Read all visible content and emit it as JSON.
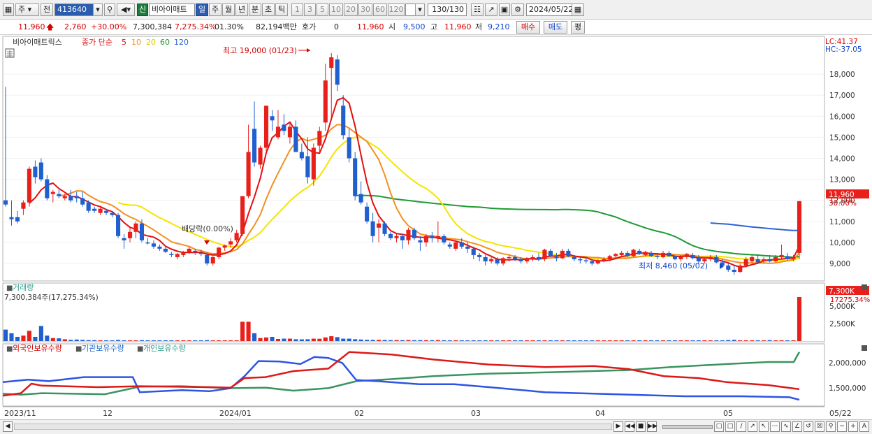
{
  "toolbar": {
    "market": "주",
    "prev_label": "전",
    "code": "413640",
    "new_badge": "신",
    "stock_name": "비아이매트",
    "periods": [
      "일",
      "주",
      "월",
      "년",
      "분",
      "초",
      "틱"
    ],
    "active_period": "일",
    "intervals": [
      "1",
      "3",
      "5",
      "10",
      "20",
      "30",
      "60",
      "120"
    ],
    "count": "130/130",
    "date": "2024/05/22"
  },
  "quote": {
    "price": "11,960",
    "change": "2,760",
    "change_pct": "+30.00%",
    "volume": "7,300,384",
    "volume_ratio": "7,275.34%",
    "turnover": "01.30%",
    "amount": "82,194백만",
    "hoga_label": "호가",
    "hoga_value": "0",
    "hoga_price": "11,960",
    "open_label": "시",
    "open": "9,500",
    "high_label": "고",
    "high": "11,960",
    "low_label": "저",
    "low": "9,210",
    "buy_label": "매수",
    "sell_label": "매도",
    "eval_label": "평"
  },
  "price_panel": {
    "title": "비아이매트릭스",
    "indicator": "종가 단순",
    "ma_labels": [
      "5",
      "10",
      "20",
      "60",
      "120"
    ],
    "lc": "LC:41.37",
    "hc": "HC:-37.05",
    "high_note": "최고 19,000 (01/23)",
    "low_note": "최저 8,460 (05/02)",
    "dividend_note": "배당락(0.00%)",
    "last_price_tag": "11,960",
    "last_pct_tag": "30.00%",
    "y_ticks": [
      "18,000",
      "17,000",
      "16,000",
      "15,000",
      "14,000",
      "13,000",
      "12,000",
      "11,000",
      "10,000",
      "9,000"
    ]
  },
  "volume_panel": {
    "title": "거래량",
    "info": "7,300,384주(17,275.34%)",
    "last_tag": "7,300K",
    "last_pct": "17275.34%",
    "y_ticks": [
      "5,000K",
      "2,500K"
    ]
  },
  "holdings_panel": {
    "legend": [
      "외국인보유수량",
      "기관보유수량",
      "개인보유수량"
    ],
    "y_ticks": [
      "2,000,000",
      "1,500,000"
    ]
  },
  "x_axis": {
    "labels": [
      "2023/11",
      "12",
      "2024/01",
      "02",
      "03",
      "04",
      "05",
      "05/22"
    ]
  },
  "colors": {
    "up": "#e8201c",
    "down": "#1f5fd0",
    "ma5": "#e11010",
    "ma10": "#f39020",
    "ma20": "#f4e400",
    "ma60": "#1c9a32",
    "ma120": "#2a62d8",
    "foreign": "#2d55e0",
    "institution": "#dd1818",
    "individual": "#3a9460"
  },
  "chart_data": {
    "type": "candlestick",
    "title": "비아이매트릭스",
    "y_range": [
      8300,
      19200
    ],
    "x_dates": [
      "2023-11",
      "2023-12",
      "2024-01",
      "2024-02",
      "2024-03",
      "2024-04",
      "2024-05",
      "2024-05-22"
    ],
    "ohlc": [
      [
        12000,
        17400,
        11700,
        11800
      ],
      [
        11200,
        12000,
        10800,
        11100
      ],
      [
        11200,
        11500,
        10900,
        11000
      ],
      [
        11600,
        12000,
        11300,
        11900
      ],
      [
        11900,
        13600,
        11700,
        13500
      ],
      [
        13600,
        13900,
        12800,
        13100
      ],
      [
        13800,
        14000,
        12900,
        13000
      ],
      [
        13000,
        13200,
        12000,
        12100
      ],
      [
        12300,
        12500,
        11900,
        12400
      ],
      [
        12300,
        12500,
        12100,
        12200
      ],
      [
        12100,
        12300,
        12000,
        12200
      ],
      [
        12200,
        12500,
        11900,
        12000
      ],
      [
        12200,
        12400,
        11900,
        12100
      ],
      [
        12100,
        12400,
        11700,
        11800
      ],
      [
        11900,
        12000,
        11400,
        11500
      ],
      [
        11600,
        11700,
        11400,
        11500
      ],
      [
        11400,
        11700,
        11300,
        11600
      ],
      [
        11500,
        11600,
        11300,
        11400
      ],
      [
        11400,
        11500,
        11200,
        11300
      ],
      [
        11300,
        11400,
        10200,
        10300
      ],
      [
        10200,
        10400,
        9700,
        10100
      ],
      [
        10200,
        10700,
        10000,
        10500
      ],
      [
        10500,
        11000,
        10200,
        10900
      ],
      [
        10900,
        11100,
        10000,
        10100
      ],
      [
        10000,
        10200,
        9900,
        9950
      ],
      [
        9950,
        10100,
        9700,
        9800
      ],
      [
        9800,
        9900,
        9600,
        9700
      ],
      [
        9700,
        9850,
        9500,
        9550
      ],
      [
        9450,
        9550,
        9300,
        9400
      ],
      [
        9300,
        9500,
        9200,
        9450
      ],
      [
        9400,
        9600,
        9300,
        9500
      ],
      [
        9550,
        9800,
        9450,
        9700
      ],
      [
        9600,
        9700,
        9400,
        9550
      ],
      [
        9500,
        9650,
        9350,
        9450
      ],
      [
        9400,
        9550,
        8900,
        9000
      ],
      [
        9000,
        9350,
        8900,
        9300
      ],
      [
        9300,
        9800,
        9200,
        9750
      ],
      [
        9750,
        9900,
        9600,
        9850
      ],
      [
        9900,
        10200,
        9750,
        10050
      ],
      [
        10100,
        10600,
        10000,
        10450
      ],
      [
        10400,
        12200,
        10300,
        12200
      ],
      [
        12200,
        15600,
        12100,
        14300
      ],
      [
        15400,
        16700,
        13600,
        13800
      ],
      [
        13700,
        14600,
        13500,
        14500
      ],
      [
        14500,
        16500,
        14300,
        16500
      ],
      [
        16000,
        16300,
        15300,
        15800
      ],
      [
        15000,
        16300,
        14900,
        15500
      ],
      [
        15600,
        16100,
        15100,
        15300
      ],
      [
        15000,
        15700,
        14700,
        15500
      ],
      [
        15500,
        15800,
        14900,
        14300
      ],
      [
        14300,
        14700,
        13900,
        14000
      ],
      [
        14100,
        15000,
        12800,
        13100
      ],
      [
        13000,
        14700,
        12700,
        14500
      ],
      [
        14600,
        15500,
        14300,
        15300
      ],
      [
        15700,
        18500,
        15300,
        17700
      ],
      [
        18300,
        19000,
        15900,
        18800
      ],
      [
        18700,
        18900,
        17200,
        17500
      ],
      [
        16500,
        17000,
        14900,
        15100
      ],
      [
        15000,
        15400,
        13800,
        14000
      ],
      [
        14000,
        14300,
        12000,
        12200
      ],
      [
        12300,
        12900,
        11800,
        11900
      ],
      [
        11700,
        11900,
        10900,
        11000
      ],
      [
        11000,
        11400,
        10000,
        10300
      ],
      [
        10700,
        11100,
        10000,
        10900
      ],
      [
        10900,
        11000,
        10300,
        10400
      ],
      [
        10400,
        10500,
        10100,
        10200
      ],
      [
        10200,
        10400,
        10000,
        10300
      ],
      [
        10300,
        10400,
        9700,
        10100
      ],
      [
        10100,
        10700,
        9900,
        10600
      ],
      [
        10600,
        10700,
        10100,
        10200
      ],
      [
        10100,
        10300,
        9600,
        10000
      ],
      [
        10000,
        10400,
        9800,
        10300
      ],
      [
        10300,
        10500,
        10000,
        10200
      ],
      [
        10200,
        11000,
        10000,
        10300
      ],
      [
        10300,
        10400,
        9900,
        10000
      ],
      [
        9900,
        10000,
        9700,
        9800
      ],
      [
        9700,
        10100,
        9600,
        10000
      ],
      [
        10000,
        10200,
        9700,
        9800
      ],
      [
        9800,
        10000,
        9500,
        9700
      ],
      [
        9700,
        9800,
        9200,
        9400
      ],
      [
        9400,
        9500,
        9100,
        9300
      ],
      [
        9300,
        9400,
        8900,
        9100
      ],
      [
        9100,
        9300,
        9000,
        9200
      ],
      [
        9200,
        9300,
        8900,
        9000
      ],
      [
        9000,
        9300,
        8900,
        9250
      ],
      [
        9250,
        9400,
        9100,
        9300
      ],
      [
        9300,
        9400,
        9100,
        9200
      ],
      [
        9200,
        9300,
        9000,
        9100
      ],
      [
        9100,
        9300,
        9000,
        9250
      ],
      [
        9200,
        9400,
        9100,
        9300
      ],
      [
        9300,
        9500,
        9100,
        9200
      ],
      [
        9200,
        9700,
        9100,
        9650
      ],
      [
        9600,
        9700,
        9300,
        9350
      ],
      [
        9300,
        9500,
        9100,
        9250
      ],
      [
        9250,
        9700,
        9200,
        9600
      ],
      [
        9600,
        9700,
        9300,
        9350
      ],
      [
        9300,
        9400,
        9100,
        9200
      ],
      [
        9200,
        9300,
        9000,
        9150
      ],
      [
        9150,
        9250,
        9000,
        9100
      ],
      [
        9100,
        9200,
        8900,
        9000
      ],
      [
        9000,
        9200,
        8950,
        9150
      ],
      [
        9150,
        9300,
        9050,
        9200
      ],
      [
        9200,
        9400,
        9100,
        9350
      ],
      [
        9350,
        9500,
        9200,
        9450
      ],
      [
        9400,
        9600,
        9300,
        9500
      ],
      [
        9500,
        9600,
        9300,
        9350
      ],
      [
        9350,
        9700,
        9300,
        9650
      ],
      [
        9600,
        9700,
        9400,
        9450
      ],
      [
        9400,
        9600,
        9350,
        9550
      ],
      [
        9500,
        9600,
        9300,
        9350
      ],
      [
        9350,
        9500,
        9200,
        9300
      ],
      [
        9300,
        9600,
        9250,
        9500
      ],
      [
        9500,
        9600,
        9300,
        9350
      ],
      [
        9350,
        9400,
        9150,
        9200
      ],
      [
        9200,
        9400,
        9100,
        9300
      ],
      [
        9300,
        9500,
        9200,
        9450
      ],
      [
        9400,
        9500,
        9200,
        9250
      ],
      [
        9250,
        9400,
        9000,
        9100
      ],
      [
        9100,
        9300,
        9000,
        9200
      ],
      [
        9200,
        9400,
        9100,
        9300
      ],
      [
        9300,
        9400,
        9000,
        9050
      ],
      [
        9050,
        9200,
        8800,
        8900
      ],
      [
        8900,
        9000,
        8600,
        8700
      ],
      [
        8700,
        8900,
        8460,
        8600
      ],
      [
        8600,
        9000,
        8550,
        8900
      ],
      [
        8900,
        9300,
        8800,
        9200
      ],
      [
        9100,
        9400,
        9000,
        9300
      ],
      [
        9200,
        9400,
        9000,
        9050
      ],
      [
        9100,
        9300,
        9000,
        9200
      ],
      [
        9200,
        9400,
        9050,
        9100
      ],
      [
        9100,
        9400,
        9050,
        9300
      ],
      [
        9300,
        9900,
        9200,
        9400
      ],
      [
        9350,
        9500,
        9150,
        9200
      ],
      [
        9200,
        9400,
        9100,
        9300
      ],
      [
        9500,
        11960,
        9210,
        11960
      ]
    ],
    "volume_k": [
      1900,
      1300,
      700,
      900,
      1700,
      700,
      2500,
      900,
      500,
      450,
      300,
      200,
      250,
      200,
      150,
      150,
      120,
      120,
      100,
      180,
      120,
      90,
      120,
      150,
      120,
      80,
      90,
      70,
      60,
      70,
      60,
      60,
      50,
      70,
      150,
      80,
      90,
      80,
      100,
      120,
      3200,
      3200,
      1300,
      500,
      600,
      700,
      350,
      400,
      400,
      300,
      280,
      300,
      400,
      380,
      600,
      800,
      650,
      400,
      400,
      300,
      250,
      200,
      200,
      200,
      180,
      150,
      160,
      150,
      170,
      140,
      150,
      140,
      140,
      160,
      130,
      120,
      130,
      120,
      110,
      100,
      100,
      90,
      110,
      100,
      90,
      100,
      100,
      90,
      90,
      110,
      90,
      100,
      90,
      120,
      110,
      100,
      90,
      90,
      90,
      110,
      100,
      100,
      90,
      100,
      90,
      110,
      100,
      100,
      90,
      110,
      100,
      90,
      90,
      100,
      100,
      90,
      110,
      100,
      90,
      100,
      100,
      110,
      160,
      200,
      120,
      110,
      100,
      100,
      110,
      150,
      110,
      100,
      100,
      120,
      7300
    ],
    "holdings": {
      "foreign_end": 1250000,
      "institution_end": 1460000,
      "individual_end": 2200000
    }
  }
}
